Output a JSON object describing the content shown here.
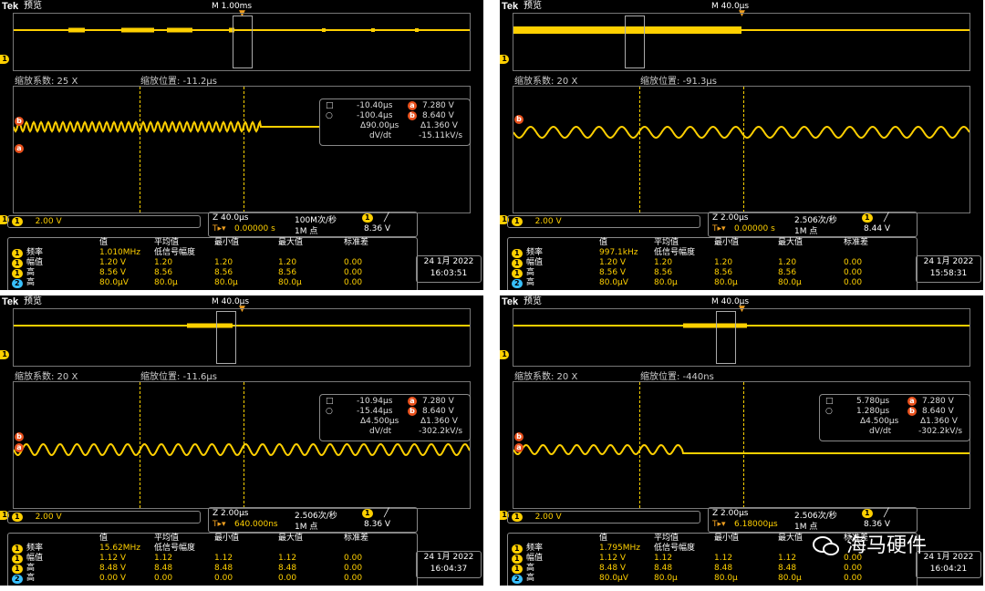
{
  "panels": [
    {
      "title_brand": "Tek",
      "title_mode": "预览",
      "timebase": "M 1.00ms",
      "zoom_factor": "缩放系数: 25 X",
      "zoom_position": "缩放位置: -11.2μs",
      "cursor": {
        "row1": {
          "val": "-10.40μs",
          "label": "a",
          "v": "7.280 V"
        },
        "row2": {
          "val": "-100.4μs",
          "label": "b",
          "v": "8.640 V"
        },
        "delta_t": "Δ90.00μs",
        "delta_v": "Δ1.360 V",
        "dvdt_label": "dV/dt",
        "dvdt": "-15.11kV/s"
      },
      "ch_scale": "2.00 V",
      "zoom_scale": "Z 40.0μs",
      "sample_rate": "100M次/秒",
      "trig_pos": "0.00000 s",
      "record": "1M 点",
      "trig_level": "8.36 V",
      "meas_head": [
        "值",
        "平均值",
        "最小值",
        "最大值",
        "标准差"
      ],
      "meas_sub": "低信号幅度",
      "meas": [
        {
          "ch": "1",
          "name": "频率",
          "val": "1.010MHz",
          "mean": "",
          "min": "",
          "max": "",
          "std": ""
        },
        {
          "ch": "1",
          "name": "幅值",
          "val": "1.20 V",
          "mean": "1.20",
          "min": "1.20",
          "max": "1.20",
          "std": "0.00"
        },
        {
          "ch": "1",
          "name": "高",
          "val": "8.56 V",
          "mean": "8.56",
          "min": "8.56",
          "max": "8.56",
          "std": "0.00"
        },
        {
          "ch": "2",
          "name": "高",
          "val": "80.0μV",
          "mean": "80.0μ",
          "min": "80.0μ",
          "max": "80.0μ",
          "std": "0.00"
        }
      ],
      "date": "24 1月 2022",
      "time": "16:03:51"
    },
    {
      "title_brand": "Tek",
      "title_mode": "预览",
      "timebase": "M 40.0μs",
      "zoom_factor": "缩放系数: 20 X",
      "zoom_position": "缩放位置: -91.3μs",
      "ch_scale": "2.00 V",
      "zoom_scale": "Z 2.00μs",
      "sample_rate": "2.506次/秒",
      "trig_pos": "0.00000 s",
      "record": "1M 点",
      "trig_level": "8.44 V",
      "meas_head": [
        "值",
        "平均值",
        "最小值",
        "最大值",
        "标准差"
      ],
      "meas_sub": "低信号幅度",
      "meas": [
        {
          "ch": "1",
          "name": "频率",
          "val": "997.1kHz",
          "mean": "",
          "min": "",
          "max": "",
          "std": ""
        },
        {
          "ch": "1",
          "name": "幅值",
          "val": "1.20 V",
          "mean": "1.20",
          "min": "1.20",
          "max": "1.20",
          "std": "0.00"
        },
        {
          "ch": "1",
          "name": "高",
          "val": "8.56 V",
          "mean": "8.56",
          "min": "8.56",
          "max": "8.56",
          "std": "0.00"
        },
        {
          "ch": "2",
          "name": "高",
          "val": "80.0μV",
          "mean": "80.0μ",
          "min": "80.0μ",
          "max": "80.0μ",
          "std": "0.00"
        }
      ],
      "date": "24 1月 2022",
      "time": "15:58:31"
    },
    {
      "title_brand": "Tek",
      "title_mode": "预览",
      "timebase": "M 40.0μs",
      "zoom_factor": "缩放系数: 20 X",
      "zoom_position": "缩放位置: -11.6μs",
      "cursor": {
        "row1": {
          "val": "-10.94μs",
          "label": "a",
          "v": "7.280 V"
        },
        "row2": {
          "val": "-15.44μs",
          "label": "b",
          "v": "8.640 V"
        },
        "delta_t": "Δ4.500μs",
        "delta_v": "Δ1.360 V",
        "dvdt_label": "dV/dt",
        "dvdt": "-302.2kV/s"
      },
      "ch_scale": "2.00 V",
      "zoom_scale": "Z 2.00μs",
      "sample_rate": "2.506次/秒",
      "trig_pos": "640.000ns",
      "record": "1M 点",
      "trig_level": "8.36 V",
      "meas_head": [
        "值",
        "平均值",
        "最小值",
        "最大值",
        "标准差"
      ],
      "meas_sub": "低信号幅度",
      "meas": [
        {
          "ch": "1",
          "name": "频率",
          "val": "15.62MHz",
          "mean": "",
          "min": "",
          "max": "",
          "std": ""
        },
        {
          "ch": "1",
          "name": "幅值",
          "val": "1.12 V",
          "mean": "1.12",
          "min": "1.12",
          "max": "1.12",
          "std": "0.00"
        },
        {
          "ch": "1",
          "name": "高",
          "val": "8.48 V",
          "mean": "8.48",
          "min": "8.48",
          "max": "8.48",
          "std": "0.00"
        },
        {
          "ch": "2",
          "name": "高",
          "val": "0.00 V",
          "mean": "0.00",
          "min": "0.00",
          "max": "0.00",
          "std": "0.00"
        }
      ],
      "date": "24 1月 2022",
      "time": "16:04:37"
    },
    {
      "title_brand": "Tek",
      "title_mode": "预览",
      "timebase": "M 40.0μs",
      "zoom_factor": "缩放系数: 20 X",
      "zoom_position": "缩放位置: -440ns",
      "cursor": {
        "row1": {
          "val": "5.780μs",
          "label": "a",
          "v": "7.280 V"
        },
        "row2": {
          "val": "1.280μs",
          "label": "b",
          "v": "8.640 V"
        },
        "delta_t": "Δ4.500μs",
        "delta_v": "Δ1.360 V",
        "dvdt_label": "dV/dt",
        "dvdt": "-302.2kV/s"
      },
      "ch_scale": "2.00 V",
      "zoom_scale": "Z 2.00μs",
      "sample_rate": "2.506次/秒",
      "trig_pos": "6.18000μs",
      "record": "1M 点",
      "trig_level": "8.36 V",
      "meas_head": [
        "值",
        "平均值",
        "最小值",
        "最大值",
        "标准差"
      ],
      "meas_sub": "低信号幅度",
      "meas": [
        {
          "ch": "1",
          "name": "频率",
          "val": "1.795MHz",
          "mean": "",
          "min": "",
          "max": "",
          "std": ""
        },
        {
          "ch": "1",
          "name": "幅值",
          "val": "1.12 V",
          "mean": "1.12",
          "min": "1.12",
          "max": "1.12",
          "std": "0.00"
        },
        {
          "ch": "1",
          "name": "高",
          "val": "8.48 V",
          "mean": "8.48",
          "min": "8.48",
          "max": "8.48",
          "std": "0.00"
        },
        {
          "ch": "2",
          "name": "高",
          "val": "80.0μV",
          "mean": "80.0μ",
          "min": "80.0μ",
          "max": "80.0μ",
          "std": "0.00"
        }
      ],
      "date": "24 1月 2022",
      "time": "16:04:21"
    }
  ],
  "watermark": "海马硬件",
  "colors": {
    "trace": "#ffd000",
    "marker": "#e8501c",
    "ch2": "#38c0ff",
    "grid": "#777777"
  }
}
